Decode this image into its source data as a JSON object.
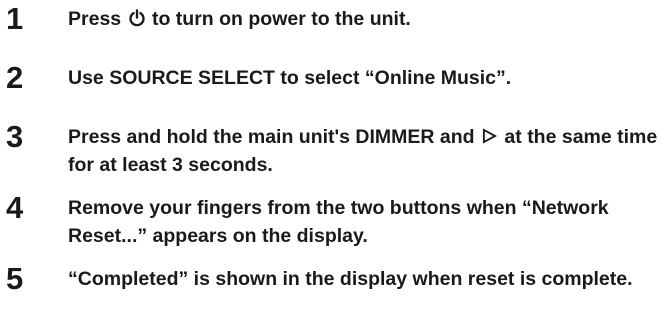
{
  "steps": [
    {
      "number": "1",
      "text_before_icon": "Press ",
      "icon": "power-icon",
      "text_after_icon": " to turn on power to the unit."
    },
    {
      "number": "2",
      "text": "Use SOURCE SELECT to select “Online Music”."
    },
    {
      "number": "3",
      "text_before_icon": "Press and hold the main unit's DIMMER and ",
      "icon": "play-icon",
      "text_after_icon": " at the same time for at least 3 seconds."
    },
    {
      "number": "4",
      "text": "Remove your fingers from the two buttons when “Network Reset...” appears on the display."
    },
    {
      "number": "5",
      "text": "“Completed” is shown in the display when reset is complete."
    }
  ]
}
